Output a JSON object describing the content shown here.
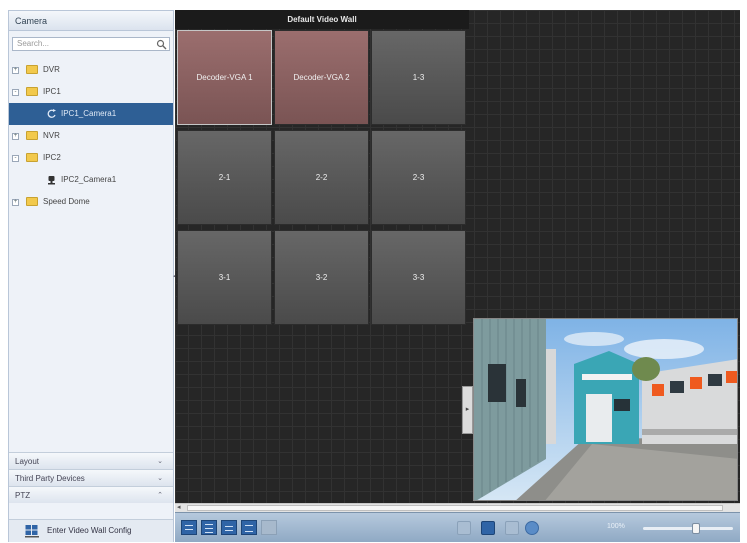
{
  "left_panel": {
    "title": "Camera",
    "search_placeholder": "Search...",
    "tree": [
      {
        "label": "DVR",
        "toggle": "+",
        "type": "folder"
      },
      {
        "label": "IPC1",
        "toggle": "-",
        "type": "folder"
      },
      {
        "label": "IPC1_Camera1",
        "type": "camera",
        "selected": true
      },
      {
        "label": "NVR",
        "toggle": "+",
        "type": "folder"
      },
      {
        "label": "IPC2",
        "toggle": "-",
        "type": "folder"
      },
      {
        "label": "IPC2_Camera1",
        "type": "camera"
      },
      {
        "label": "Speed Dome",
        "toggle": "+",
        "type": "folder"
      }
    ],
    "accordions": [
      {
        "label": "Layout",
        "chevron": "⌄"
      },
      {
        "label": "Third Party Devices",
        "chevron": "⌄"
      },
      {
        "label": "PTZ",
        "chevron": "⌃"
      }
    ],
    "enter_button": "Enter Video Wall Config"
  },
  "wall": {
    "title": "Default Video Wall",
    "screens": [
      {
        "label": "Decoder-VGA 1",
        "kind": "decoder",
        "active": true
      },
      {
        "label": "Decoder-VGA 2",
        "kind": "decoder",
        "active": false
      },
      {
        "label": "1-3",
        "kind": "plain"
      },
      {
        "label": "2-1",
        "kind": "plain"
      },
      {
        "label": "2-2",
        "kind": "plain"
      },
      {
        "label": "2-3",
        "kind": "plain"
      },
      {
        "label": "3-1",
        "kind": "plain"
      },
      {
        "label": "3-2",
        "kind": "plain"
      },
      {
        "label": "3-3",
        "kind": "plain"
      }
    ]
  },
  "toolbar": {
    "zoom_label": "100%",
    "zoom_fraction": 0.6
  },
  "colors": {
    "selection": "#2e5f95",
    "decoder_screen": "#8b6262",
    "toolbar": "#9fb6cf"
  }
}
